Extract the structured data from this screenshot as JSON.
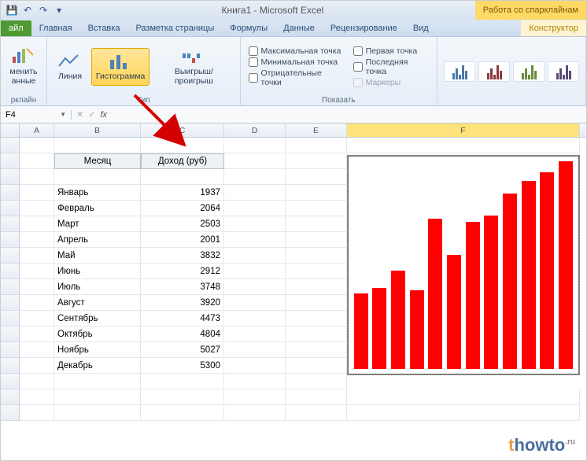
{
  "title": "Книга1 - Microsoft Excel",
  "context_tab_title": "Работа со спарклайнам",
  "tabs": {
    "file": "айл",
    "home": "Главная",
    "insert": "Вставка",
    "layout": "Разметка страницы",
    "formulas": "Формулы",
    "data": "Данные",
    "review": "Рецензирование",
    "view": "Вид",
    "design": "Конструктор"
  },
  "ribbon": {
    "edit_data": "менить\nанные",
    "group_spark": "рклайн",
    "line": "Линия",
    "column": "Гистограмма",
    "winloss": "Выигрыш/проигрыш",
    "group_type": "Тип",
    "max_point": "Максимальная точка",
    "min_point": "Минимальная точка",
    "neg_point": "Отрицательные точки",
    "first_point": "Первая точка",
    "last_point": "Последняя точка",
    "markers": "Маркеры",
    "group_show": "Показать"
  },
  "name_box": "F4",
  "table": {
    "header_month": "Месяц",
    "header_income": "Доход (руб)",
    "rows": [
      {
        "m": "Январь",
        "v": "1937"
      },
      {
        "m": "Февраль",
        "v": "2064"
      },
      {
        "m": "Март",
        "v": "2503"
      },
      {
        "m": "Апрель",
        "v": "2001"
      },
      {
        "m": "Май",
        "v": "3832"
      },
      {
        "m": "Июнь",
        "v": "2912"
      },
      {
        "m": "Июль",
        "v": "3748"
      },
      {
        "m": "Август",
        "v": "3920"
      },
      {
        "m": "Сентябрь",
        "v": "4473"
      },
      {
        "m": "Октябрь",
        "v": "4804"
      },
      {
        "m": "Ноябрь",
        "v": "5027"
      },
      {
        "m": "Декабрь",
        "v": "5300"
      }
    ]
  },
  "col_headers": [
    "A",
    "B",
    "C",
    "D",
    "E",
    "F"
  ],
  "chart_data": {
    "type": "bar",
    "categories": [
      "Январь",
      "Февраль",
      "Март",
      "Апрель",
      "Май",
      "Июнь",
      "Июль",
      "Август",
      "Сентябрь",
      "Октябрь",
      "Ноябрь",
      "Декабрь"
    ],
    "values": [
      1937,
      2064,
      2503,
      2001,
      3832,
      2912,
      3748,
      3920,
      4473,
      4804,
      5027,
      5300
    ],
    "color": "#ff0000",
    "ylim": [
      0,
      5300
    ]
  },
  "watermark": {
    "pre": "t",
    "main": "howto",
    "suf": ".ru"
  }
}
